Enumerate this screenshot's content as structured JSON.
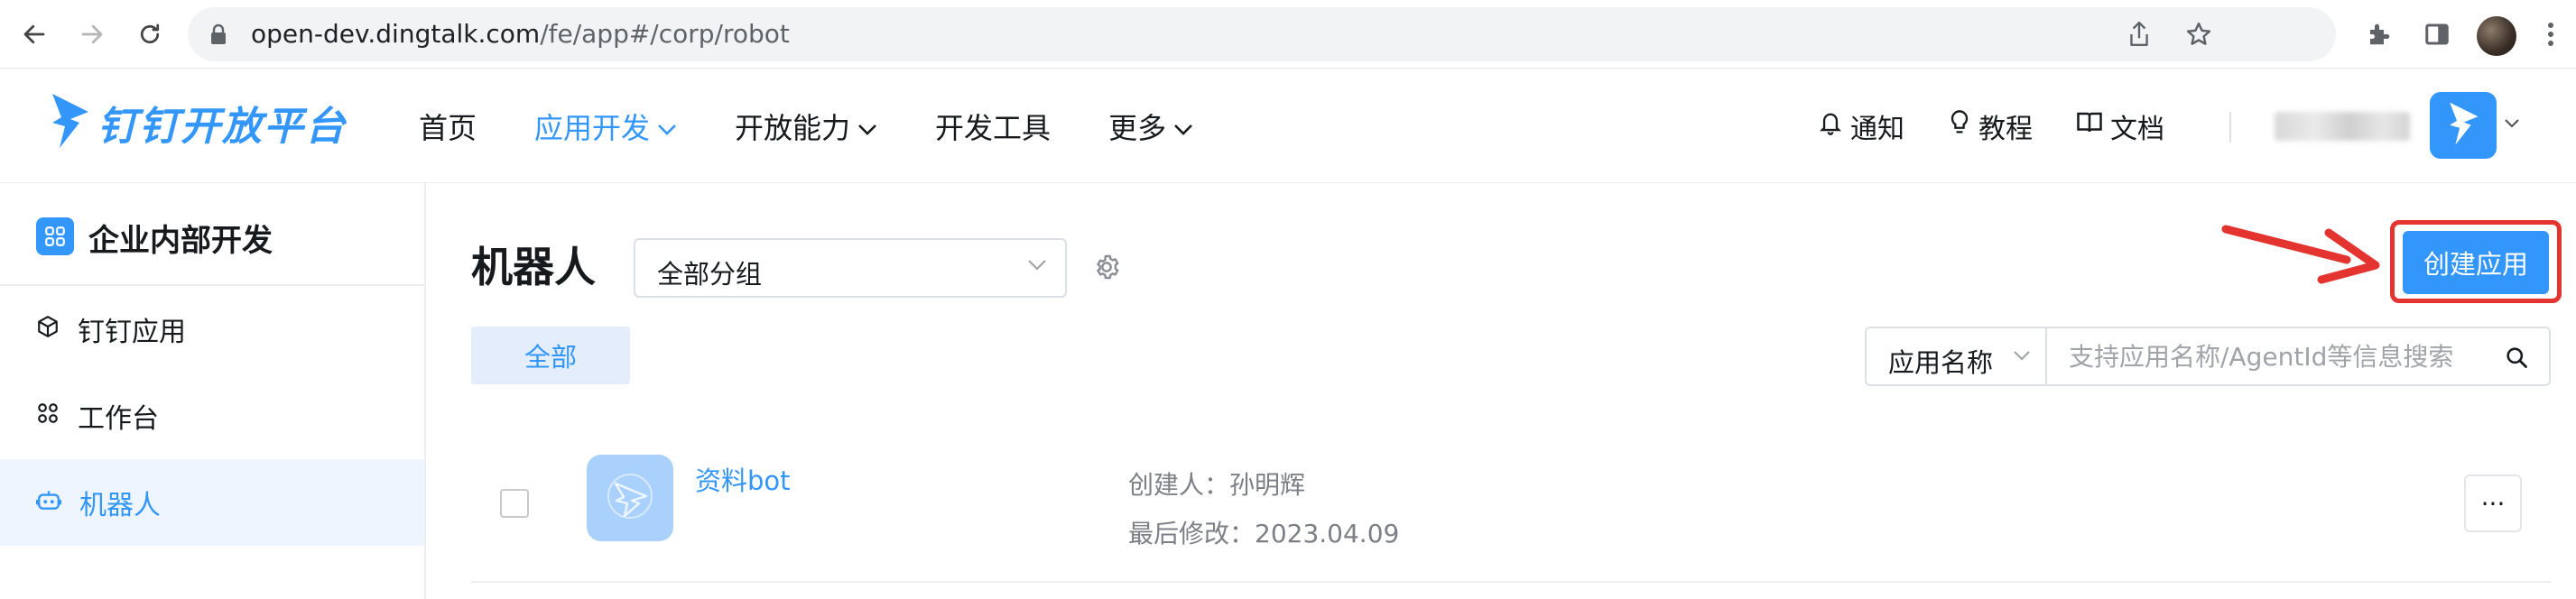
{
  "browser": {
    "url_host": "open-dev.dingtalk.com",
    "url_path": "/fe/app#/corp/robot"
  },
  "header": {
    "logo_text": "钉钉开放平台",
    "nav": [
      {
        "label": "首页"
      },
      {
        "label": "应用开发"
      },
      {
        "label": "开放能力"
      },
      {
        "label": "开发工具"
      },
      {
        "label": "更多"
      }
    ],
    "links": {
      "notify": "通知",
      "tutorial": "教程",
      "docs": "文档"
    }
  },
  "sidebar": {
    "title": "企业内部开发",
    "items": [
      {
        "label": "钉钉应用"
      },
      {
        "label": "工作台"
      },
      {
        "label": "机器人"
      }
    ]
  },
  "main": {
    "title": "机器人",
    "group_select": "全部分组",
    "create_button": "创建应用",
    "tab_all": "全部",
    "search_type": "应用名称",
    "search_placeholder": "支持应用名称/AgentId等信息搜索",
    "apps": [
      {
        "name": "资料bot",
        "creator_label": "创建人：",
        "creator": "孙明辉",
        "modified_label": "最后修改：",
        "modified": "2023.04.09",
        "more": "···"
      }
    ]
  },
  "colors": {
    "accent": "#3296fa",
    "highlight_frame": "#e3342f",
    "sidebar_active_bg": "#eef5ff"
  }
}
